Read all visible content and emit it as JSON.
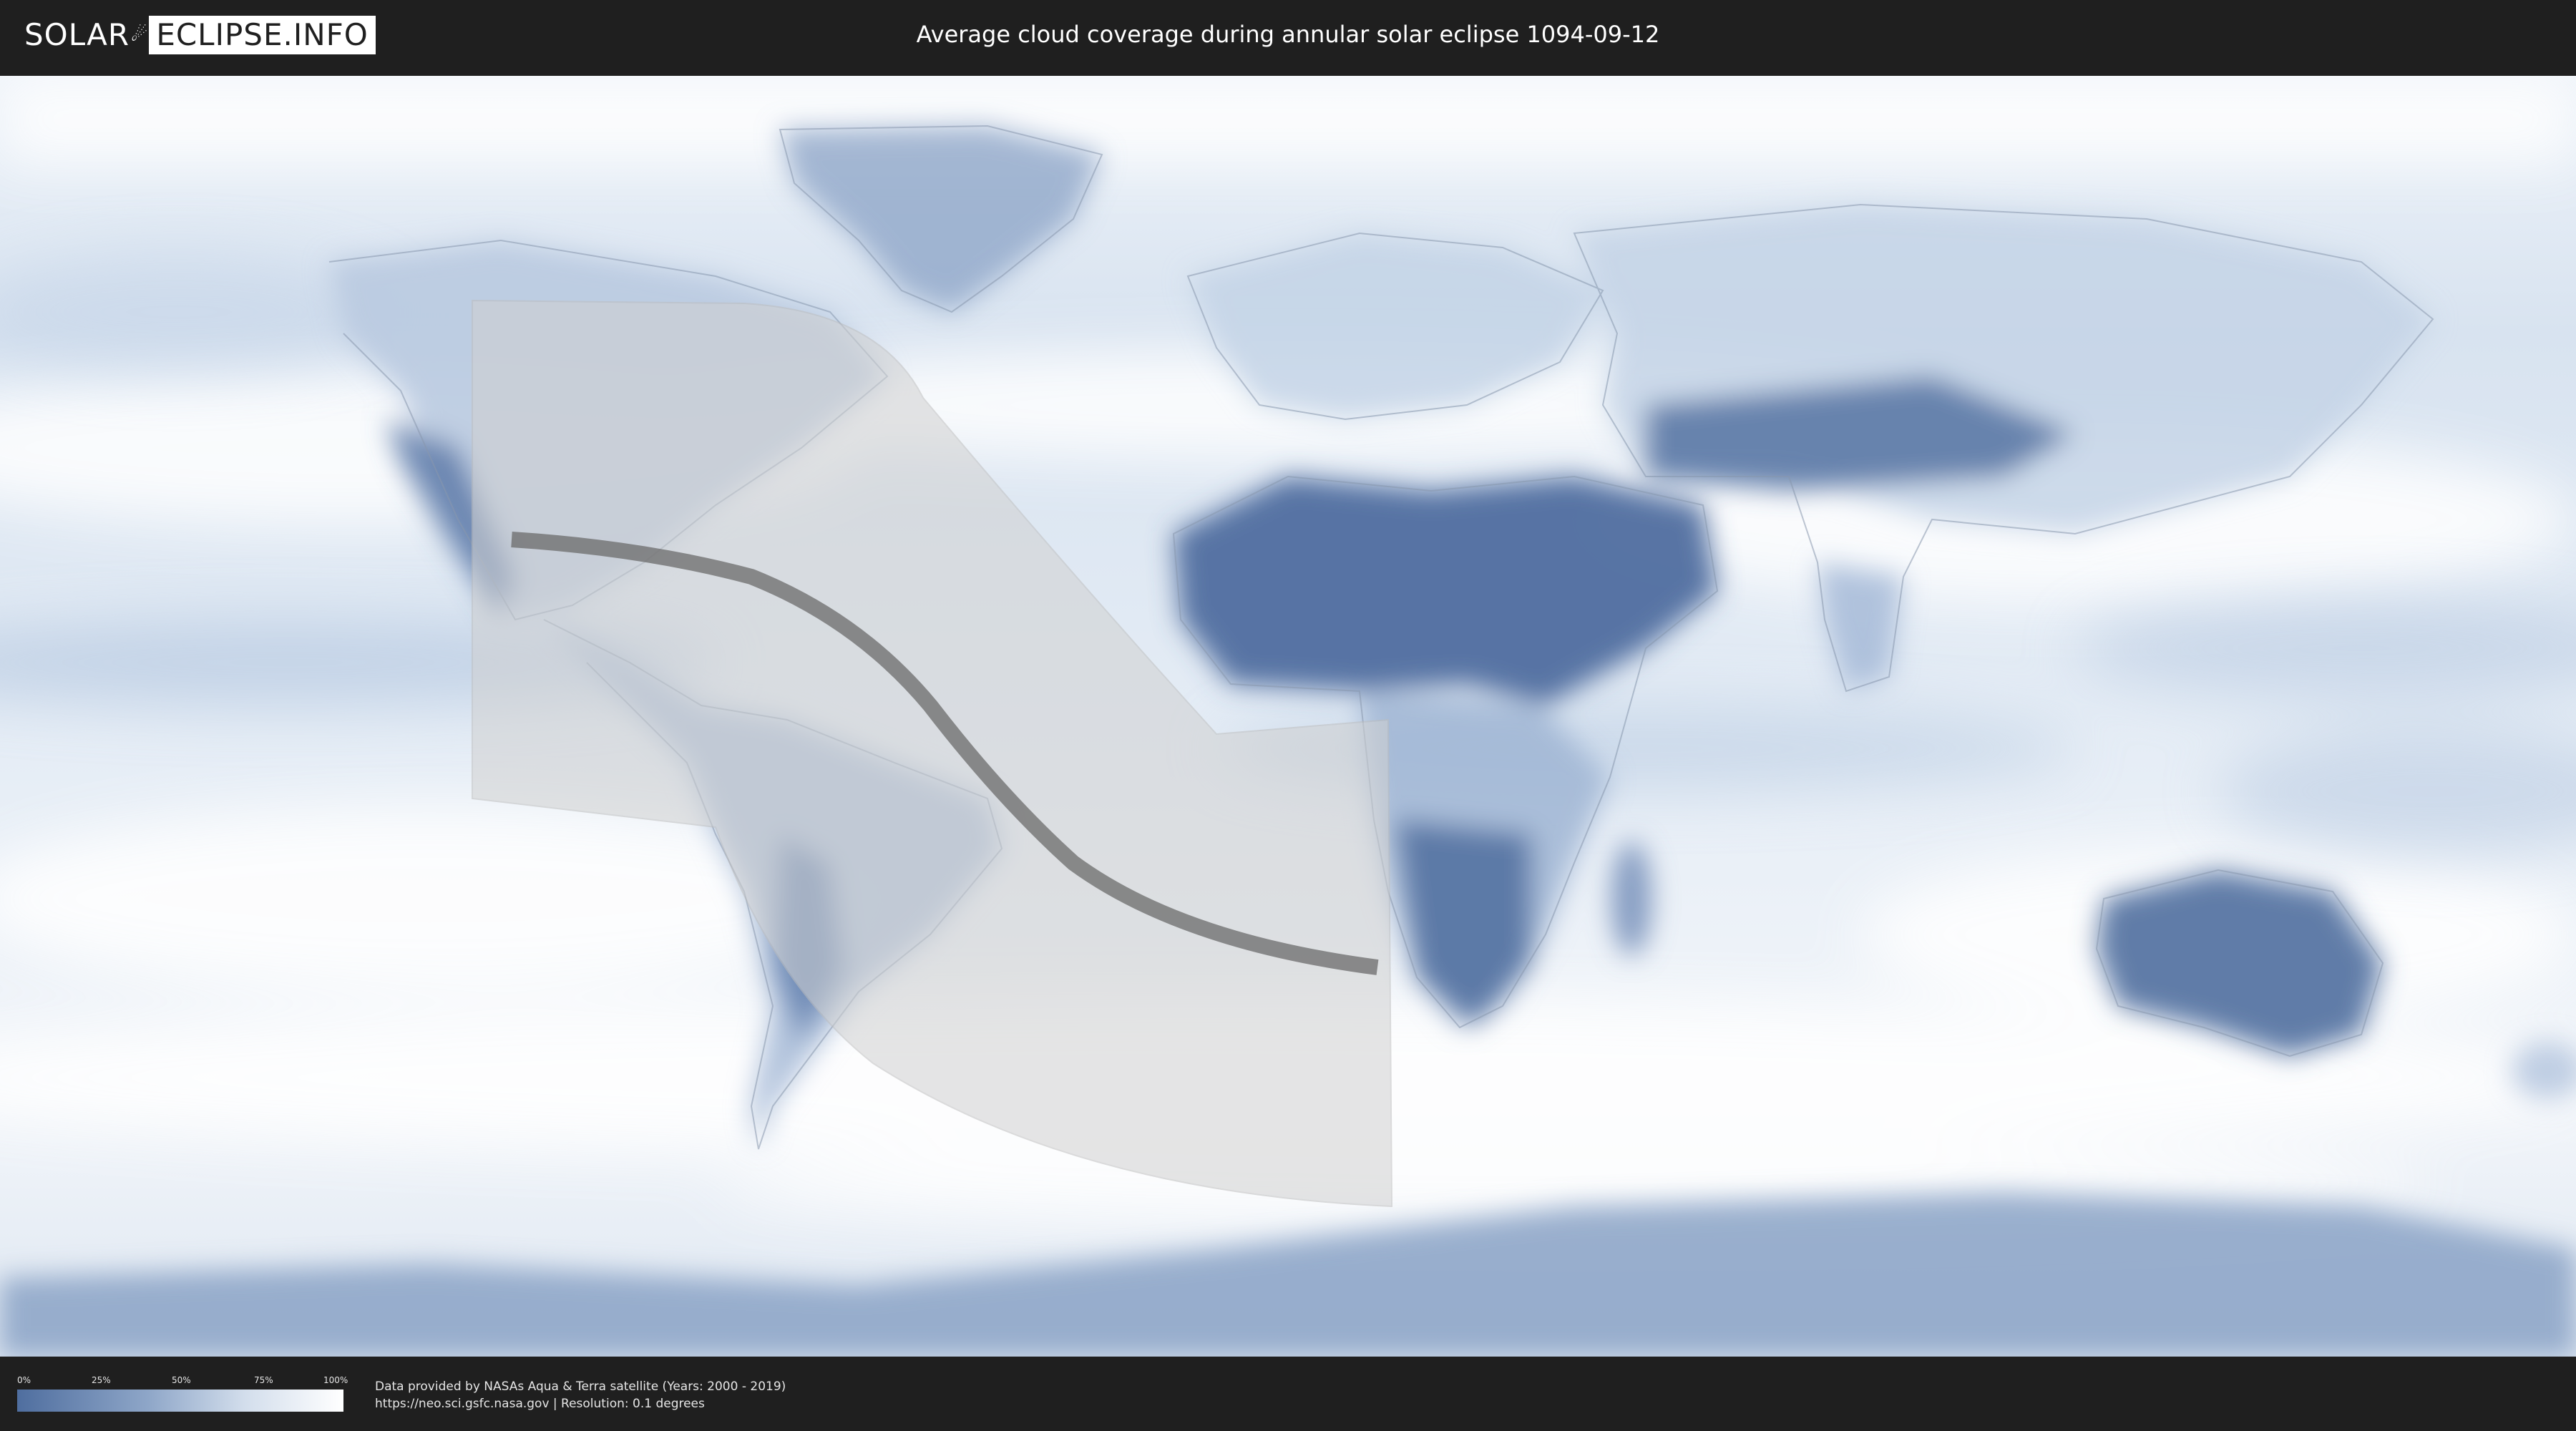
{
  "header": {
    "logo_solar": "SOLAR",
    "logo_mark": "☄",
    "logo_eclipse": "ECLIPSE.INFO",
    "title": "Average cloud coverage during annular solar eclipse 1094-09-12"
  },
  "legend": {
    "ticks": [
      "0%",
      "25%",
      "50%",
      "75%",
      "100%"
    ],
    "colors": {
      "low": "#4f6e9f",
      "high": "#ffffff"
    }
  },
  "footer": {
    "line1": "Data provided by NASAs Aqua & Terra satellite (Years: 2000 - 2019)",
    "line2": "https://neo.sci.gsfc.nasa.gov | Resolution: 0.1 degrees"
  },
  "map": {
    "ocean_color": "#dfe9f4",
    "dense_cloud_color": "#ffffff",
    "clear_sky_color": "#4f6e9f",
    "eclipse_zone_color": "#d2d2d2",
    "central_path_color": "#666666"
  }
}
